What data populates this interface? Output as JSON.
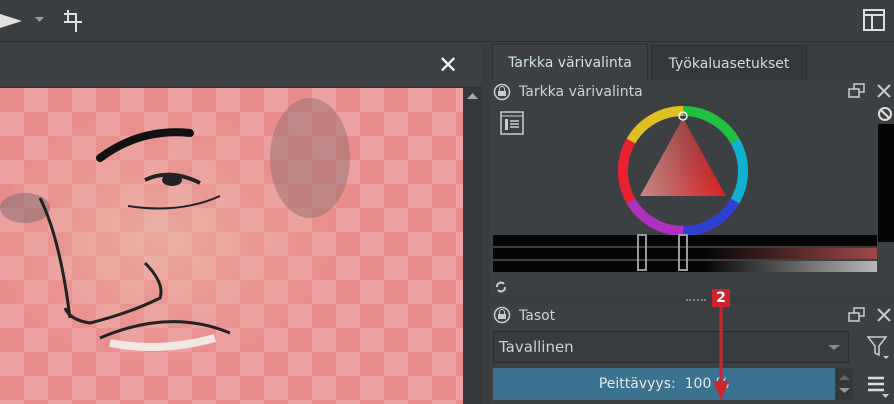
{
  "toolbar": {
    "icons": [
      "play-icon",
      "dropdown-arrow-icon",
      "crop-icon",
      "layout-icon"
    ]
  },
  "canvas": {
    "close_label": "✕"
  },
  "dock_tabs": [
    {
      "label": "Tarkka värivalinta",
      "active": true
    },
    {
      "label": "Työkaluasetukset",
      "active": false
    }
  ],
  "color_panel": {
    "title": "Tarkka värivalinta"
  },
  "layers_panel": {
    "title": "Tasot",
    "blend_mode": "Tavallinen",
    "opacity_label": "Peittävyys:",
    "opacity_value": "100 %",
    "opacity_percent": 100
  },
  "annotation": {
    "number": "2",
    "color": "#d0232f"
  },
  "colors": {
    "opacity_bar": "#3a7290",
    "canvas": "#e98c8c"
  }
}
